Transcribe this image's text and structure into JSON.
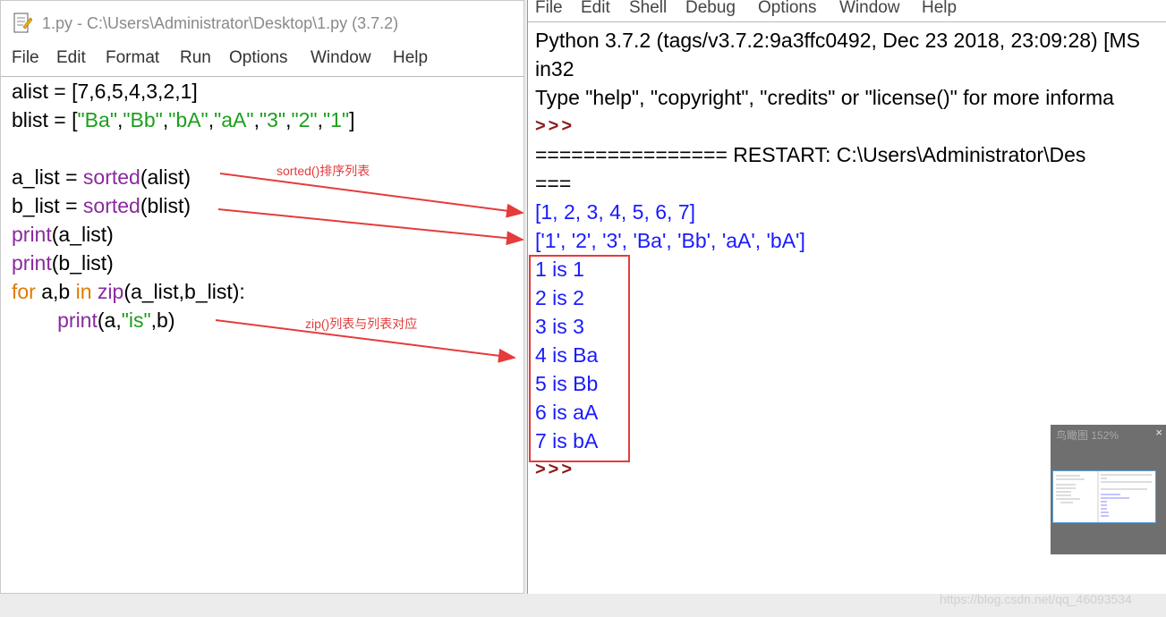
{
  "editor": {
    "title": "1.py - C:\\Users\\Administrator\\Desktop\\1.py (3.7.2)",
    "menu": [
      "File",
      "Edit",
      "Format",
      "Run",
      "Options",
      "Window",
      "Help"
    ],
    "code": [
      [
        {
          "t": "alist = [7,6,5,4,3,2,1]",
          "c": "n"
        }
      ],
      [
        {
          "t": "blist = [",
          "c": "n"
        },
        {
          "t": "\"Ba\"",
          "c": "s"
        },
        {
          "t": ",",
          "c": "n"
        },
        {
          "t": "\"Bb\"",
          "c": "s"
        },
        {
          "t": ",",
          "c": "n"
        },
        {
          "t": "\"bA\"",
          "c": "s"
        },
        {
          "t": ",",
          "c": "n"
        },
        {
          "t": "\"aA\"",
          "c": "s"
        },
        {
          "t": ",",
          "c": "n"
        },
        {
          "t": "\"3\"",
          "c": "s"
        },
        {
          "t": ",",
          "c": "n"
        },
        {
          "t": "\"2\"",
          "c": "s"
        },
        {
          "t": ",",
          "c": "n"
        },
        {
          "t": "\"1\"",
          "c": "s"
        },
        {
          "t": "]",
          "c": "n"
        }
      ],
      [],
      [
        {
          "t": "a_list = ",
          "c": "n"
        },
        {
          "t": "sorted",
          "c": "b"
        },
        {
          "t": "(alist)",
          "c": "n"
        }
      ],
      [
        {
          "t": "b_list = ",
          "c": "n"
        },
        {
          "t": "sorted",
          "c": "b"
        },
        {
          "t": "(blist)",
          "c": "n"
        }
      ],
      [
        {
          "t": "print",
          "c": "b"
        },
        {
          "t": "(a_list)",
          "c": "n"
        }
      ],
      [
        {
          "t": "print",
          "c": "b"
        },
        {
          "t": "(b_list)",
          "c": "n"
        }
      ],
      [
        {
          "t": "for",
          "c": "k"
        },
        {
          "t": " a,b ",
          "c": "n"
        },
        {
          "t": "in",
          "c": "k"
        },
        {
          "t": " ",
          "c": "n"
        },
        {
          "t": "zip",
          "c": "b"
        },
        {
          "t": "(a_list,b_list):",
          "c": "n"
        }
      ],
      [
        {
          "t": "        ",
          "c": "n"
        },
        {
          "t": "print",
          "c": "b"
        },
        {
          "t": "(a,",
          "c": "n"
        },
        {
          "t": "\"is\"",
          "c": "s"
        },
        {
          "t": ",b)",
          "c": "n"
        }
      ]
    ]
  },
  "shell": {
    "menu": [
      "File",
      "Edit",
      "Shell",
      "Debug",
      "Options",
      "Window",
      "Help"
    ],
    "lines": [
      {
        "t": "Python 3.7.2 (tags/v3.7.2:9a3ffc0492, Dec 23 2018, 23:09:28) [MS",
        "c": "n"
      },
      {
        "t": "in32",
        "c": "n"
      },
      {
        "t": "Type \"help\", \"copyright\", \"credits\" or \"license()\" for more informa",
        "c": "n"
      },
      {
        "t": ">>>",
        "c": "prompt"
      },
      {
        "t": "================ RESTART: C:\\Users\\Administrator\\Des",
        "c": "n"
      },
      {
        "t": "===",
        "c": "n"
      },
      {
        "t": "[1, 2, 3, 4, 5, 6, 7]",
        "c": "out"
      },
      {
        "t": "['1', '2', '3', 'Ba', 'Bb', 'aA', 'bA']",
        "c": "out"
      },
      {
        "t": "1 is 1",
        "c": "out"
      },
      {
        "t": "2 is 2",
        "c": "out"
      },
      {
        "t": "3 is 3",
        "c": "out"
      },
      {
        "t": "4 is Ba",
        "c": "out"
      },
      {
        "t": "5 is Bb",
        "c": "out"
      },
      {
        "t": "6 is aA",
        "c": "out"
      },
      {
        "t": "7 is bA",
        "c": "out"
      },
      {
        "t": ">>>",
        "c": "prompt"
      }
    ]
  },
  "annotations": {
    "sorted": "sorted()排序列表",
    "zip": "zip()列表与列表对应"
  },
  "minimap": {
    "title": "鸟瞰图 152%",
    "close": "×"
  },
  "watermark": "https://blog.csdn.net/qq_46093534",
  "colors": {
    "keyword": "#e07b00",
    "builtin": "#8a2a9e",
    "string": "#1d9e1d",
    "output": "#1a1aff",
    "prompt": "#8b1a1a",
    "annotation": "#e23b3b"
  }
}
